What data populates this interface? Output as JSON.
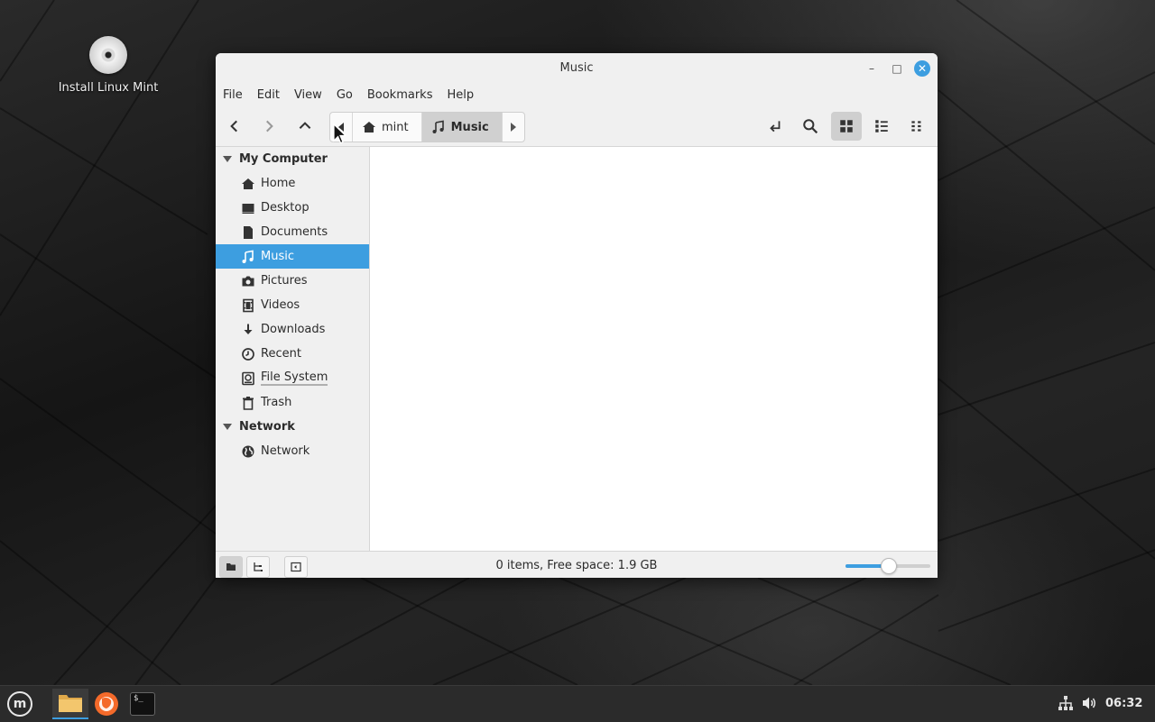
{
  "desktop": {
    "icon_label": "Install Linux Mint"
  },
  "window": {
    "title": "Music",
    "min_glyph": "–",
    "max_glyph": "□",
    "close_glyph": "✕"
  },
  "menubar": [
    "File",
    "Edit",
    "View",
    "Go",
    "Bookmarks",
    "Help"
  ],
  "pathbar": {
    "home_segment": "mint",
    "current_segment": "Music"
  },
  "sidebar": {
    "sections": [
      {
        "title": "My Computer",
        "items": [
          {
            "label": "Home",
            "icon": "home-icon"
          },
          {
            "label": "Desktop",
            "icon": "desktop-icon"
          },
          {
            "label": "Documents",
            "icon": "documents-icon"
          },
          {
            "label": "Music",
            "icon": "music-icon",
            "selected": true
          },
          {
            "label": "Pictures",
            "icon": "camera-icon"
          },
          {
            "label": "Videos",
            "icon": "film-icon"
          },
          {
            "label": "Downloads",
            "icon": "download-icon"
          },
          {
            "label": "Recent",
            "icon": "clock-icon"
          },
          {
            "label": "File System",
            "icon": "drive-icon"
          },
          {
            "label": "Trash",
            "icon": "trash-icon"
          }
        ]
      },
      {
        "title": "Network",
        "items": [
          {
            "label": "Network",
            "icon": "globe-icon"
          }
        ]
      }
    ]
  },
  "statusbar": {
    "text": "0 items, Free space: 1.9 GB",
    "zoom_fraction": 0.5
  },
  "taskbar": {
    "clock": "06:32",
    "terminal_glyph": "$_"
  },
  "colors": {
    "accent": "#3d9ee0",
    "window_bg": "#f0f0f0",
    "taskbar_bg": "#2b2b2b"
  }
}
